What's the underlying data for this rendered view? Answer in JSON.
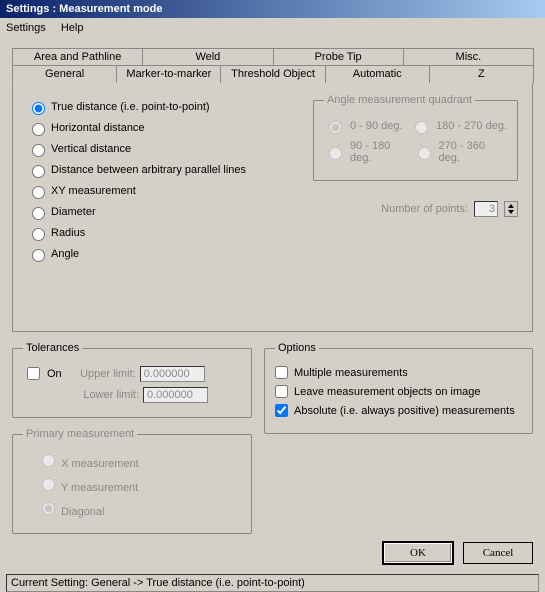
{
  "window": {
    "title": "Settings : Measurement mode"
  },
  "menu": {
    "settings": "Settings",
    "help": "Help"
  },
  "tabs_top": {
    "area": "Area and Pathline",
    "weld": "Weld",
    "probe": "Probe Tip",
    "misc": "Misc."
  },
  "tabs_bottom": {
    "general": "General",
    "m2m": "Marker-to-marker",
    "threshold": "Threshold Object",
    "automatic": "Automatic",
    "z": "Z"
  },
  "measure": {
    "truedist": "True distance (i.e. point-to-point)",
    "hdist": "Horizontal distance",
    "vdist": "Vertical distance",
    "parallel": "Distance between arbitrary parallel lines",
    "xy": "XY measurement",
    "diameter": "Diameter",
    "radius": "Radius",
    "angle": "Angle"
  },
  "angleq": {
    "legend": "Angle measurement quadrant",
    "q1": "0 - 90 deg.",
    "q2": "180 - 270 deg.",
    "q3": "90 - 180 deg.",
    "q4": "270 - 360 deg."
  },
  "numpoints": {
    "label": "Number of points:",
    "value": "3"
  },
  "tolerances": {
    "legend": "Tolerances",
    "on": "On",
    "upper_label": "Upper limit:",
    "upper_value": "0.000000",
    "lower_label": "Lower limit:",
    "lower_value": "0.000000"
  },
  "primary": {
    "legend": "Primary measurement",
    "x": "X measurement",
    "y": "Y measurement",
    "diag": "Diagonal"
  },
  "options": {
    "legend": "Options",
    "multiple": "Multiple measurements",
    "leave": "Leave measurement objects on image",
    "absolute": "Absolute (i.e. always positive) measurements"
  },
  "buttons": {
    "ok": "OK",
    "cancel": "Cancel"
  },
  "status": "Current Setting: General -> True distance (i.e. point-to-point)"
}
